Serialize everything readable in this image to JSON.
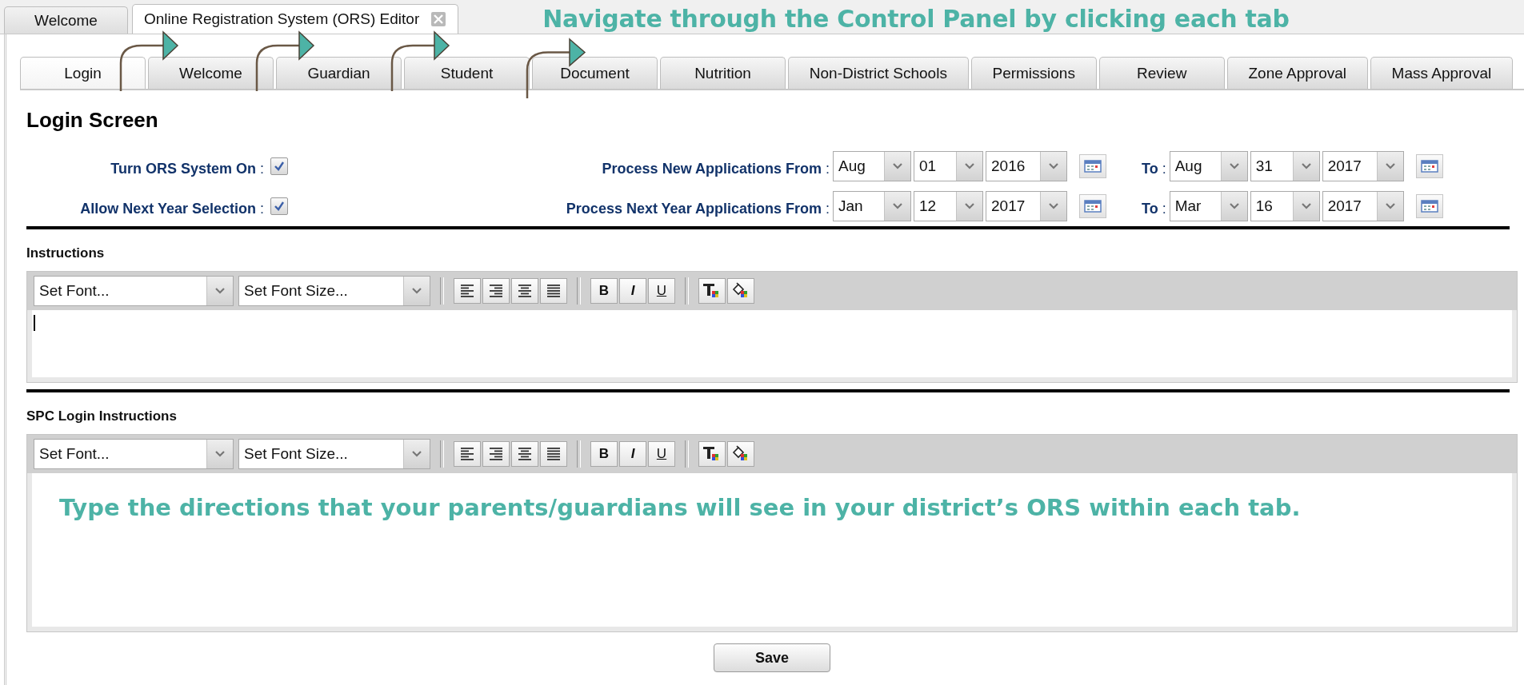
{
  "outer_tabs": [
    {
      "label": "Welcome",
      "selected": false,
      "closable": false
    },
    {
      "label": "Online Registration System (ORS) Editor",
      "selected": true,
      "closable": true
    }
  ],
  "header_note": "Navigate through the Control Panel by clicking each tab",
  "inner_tabs": [
    {
      "label": "Login",
      "selected": true
    },
    {
      "label": "Welcome",
      "selected": false
    },
    {
      "label": "Guardian",
      "selected": false
    },
    {
      "label": "Student",
      "selected": false
    },
    {
      "label": "Document",
      "selected": false
    },
    {
      "label": "Nutrition",
      "selected": false
    },
    {
      "label": "Non-District Schools",
      "selected": false
    },
    {
      "label": "Permissions",
      "selected": false
    },
    {
      "label": "Review",
      "selected": false
    },
    {
      "label": "Zone Approval",
      "selected": false
    },
    {
      "label": "Mass Approval",
      "selected": false
    }
  ],
  "heading": "Login Screen",
  "settings": [
    {
      "label": "**Turn ORS System On** :",
      "checked": true,
      "range_label": "**Process New Applications From** :",
      "from": {
        "month": "Aug",
        "day": "01",
        "year": "2016"
      },
      "to_label": "**To** :",
      "to": {
        "month": "Aug",
        "day": "31",
        "year": "2017"
      }
    },
    {
      "label": "**Allow Next Year Selection** :",
      "checked": true,
      "range_label": "**Process Next Year Applications From** :",
      "from": {
        "month": "Jan",
        "day": "12",
        "year": "2017"
      },
      "to_label": "**To** :",
      "to": {
        "month": "Mar",
        "day": "16",
        "year": "2017"
      }
    }
  ],
  "editors": [
    {
      "label": "Instructions",
      "font": "Set Font...",
      "font_size": "Set Font Size...",
      "format_buttons": [
        "B",
        "I",
        "U"
      ],
      "focused": true
    },
    {
      "label": "SPC Login Instructions",
      "font": "Set Font...",
      "font_size": "Set Font Size...",
      "format_buttons": [
        "B",
        "I",
        "U"
      ],
      "focused": false,
      "note": "Type the directions that your parents/guardians will see in your district’s ORS within each tab."
    }
  ],
  "save_button": "Save"
}
